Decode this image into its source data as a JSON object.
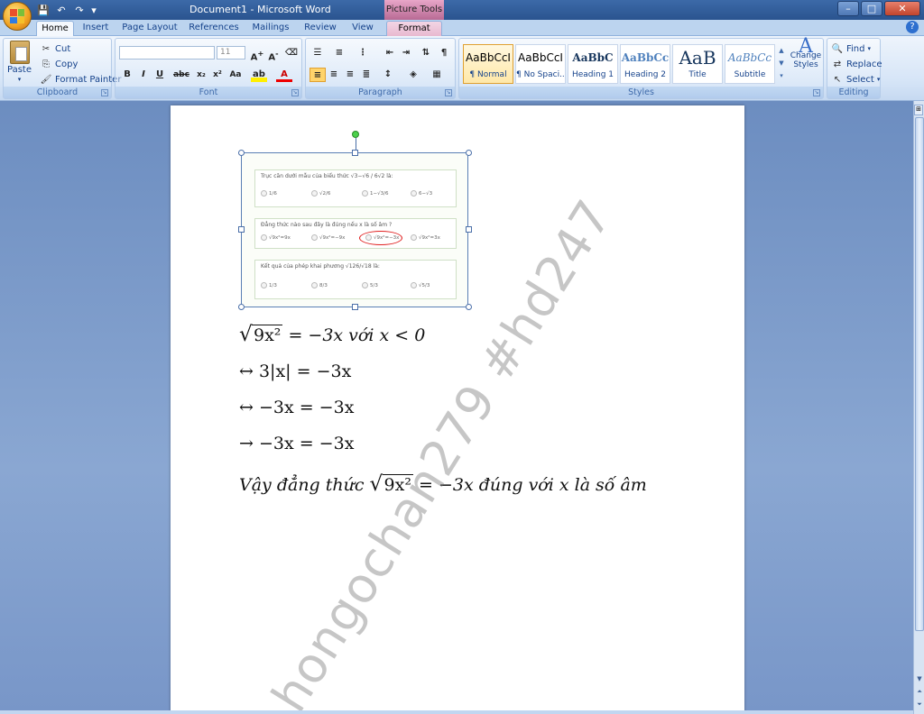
{
  "window": {
    "title": "Document1 - Microsoft Word",
    "context_tools": "Picture Tools",
    "controls": {
      "minimize": "–",
      "maximize": "□",
      "close": "✕"
    }
  },
  "qat": {
    "save_icon": "save-icon",
    "undo_icon": "undo-icon",
    "redo_icon": "redo-icon"
  },
  "tabs": [
    "Home",
    "Insert",
    "Page Layout",
    "References",
    "Mailings",
    "Review",
    "View",
    "Format"
  ],
  "ribbon": {
    "clipboard": {
      "label": "Clipboard",
      "paste": "Paste",
      "cut": "Cut",
      "copy": "Copy",
      "format_painter": "Format Painter"
    },
    "font": {
      "label": "Font",
      "size": "11"
    },
    "paragraph": {
      "label": "Paragraph"
    },
    "styles": {
      "label": "Styles",
      "items": [
        {
          "sample": "AaBbCcI",
          "name": "¶ Normal"
        },
        {
          "sample": "AaBbCcI",
          "name": "¶ No Spaci..."
        },
        {
          "sample": "AaBbC",
          "name": "Heading 1"
        },
        {
          "sample": "AaBbCc",
          "name": "Heading 2"
        },
        {
          "sample": "AaB",
          "name": "Title"
        },
        {
          "sample": "AaBbCc",
          "name": "Subtitle"
        }
      ],
      "change_styles": "Change Styles"
    },
    "editing": {
      "label": "Editing",
      "find": "Find",
      "replace": "Replace",
      "select": "Select"
    }
  },
  "picture": {
    "q1": {
      "text": "Trục căn dưới mẫu của biểu thức √3−√6 / 6√2 là:",
      "options": [
        "1/6",
        "√2/6",
        "1−√3/6",
        "6−√3"
      ]
    },
    "q2": {
      "text": "Đẳng thức nào sau đây là đúng nếu x là số âm ?",
      "options": [
        "√9x²=9x",
        "√9x²=−9x",
        "√9x²=−3x",
        "√9x²=3x"
      ]
    },
    "q3": {
      "text": "Kết quả của phép khai phương √126/√18 là:",
      "options": [
        "1/3",
        "8/3",
        "5/3",
        "√5/3"
      ]
    }
  },
  "math": {
    "line1": {
      "sqrt": "9x²",
      "rest": " = −3x với x < 0"
    },
    "line2": "↔ 3|x| = −3x",
    "line3": "↔ −3x = −3x",
    "line4": "→ −3x = −3x",
    "line5": {
      "prefix": "Vậy đẳng thức ",
      "sqrt": "9x²",
      "suffix": " = −3x đúng với x là số âm"
    }
  },
  "watermark": "hongochan279 #hd247",
  "colors": {
    "titlebar": "#2a548f",
    "ribbon": "#d6e5f7",
    "workspace": "#7896c8",
    "page": "#ffffff",
    "highlight_circle": "#e02020"
  }
}
